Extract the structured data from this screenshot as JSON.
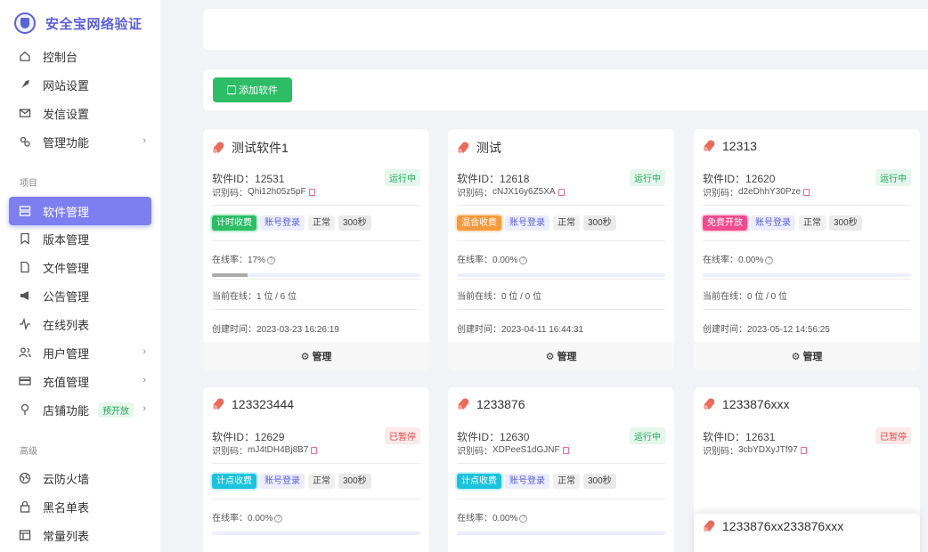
{
  "brand": {
    "title": "安全宝网络验证"
  },
  "sidebar": {
    "items_top": [
      {
        "label": "控制台",
        "icon": "home-icon"
      },
      {
        "label": "网站设置",
        "icon": "rocket-icon"
      },
      {
        "label": "发信设置",
        "icon": "mail-icon"
      },
      {
        "label": "管理功能",
        "icon": "settings-icon",
        "has_children": true
      }
    ],
    "section_project": "项目",
    "items_project": [
      {
        "label": "软件管理",
        "icon": "server-icon",
        "active": true
      },
      {
        "label": "版本管理",
        "icon": "bookmark-icon"
      },
      {
        "label": "文件管理",
        "icon": "file-icon"
      },
      {
        "label": "公告管理",
        "icon": "megaphone-icon"
      },
      {
        "label": "在线列表",
        "icon": "activity-icon"
      },
      {
        "label": "用户管理",
        "icon": "users-icon",
        "has_children": true
      },
      {
        "label": "充值管理",
        "icon": "card-icon",
        "has_children": true
      },
      {
        "label": "店铺功能",
        "icon": "shop-icon",
        "has_children": true,
        "badge": "预开放"
      }
    ],
    "section_advanced": "高级",
    "items_advanced": [
      {
        "label": "云防火墙",
        "icon": "globe-icon"
      },
      {
        "label": "黑名单表",
        "icon": "lock-icon"
      },
      {
        "label": "常量列表",
        "icon": "table-icon"
      }
    ]
  },
  "toolbar": {
    "add_label": "添加软件"
  },
  "labels": {
    "id_prefix": "软件ID：",
    "code_prefix": "识别码：",
    "online_rate": "在线率：",
    "current_online": "当前在线：",
    "created": "创建时间：",
    "manage": "管理"
  },
  "cards": [
    {
      "name": "测试软件1",
      "id": "12531",
      "code": "Qhi12h05z5pF",
      "status": "运行中",
      "status_type": "run",
      "billing": "计时收费",
      "billing_color": "green",
      "login": "账号登录",
      "state": "正常",
      "interval": "300秒",
      "rate": "17%",
      "rate_value": 0.17,
      "current": "1 位 / 6 位",
      "created": "2023-03-23 16:26:19"
    },
    {
      "name": "测试",
      "id": "12618",
      "code": "cNJX16y6Z5XA",
      "status": "运行中",
      "status_type": "run",
      "billing": "混合收费",
      "billing_color": "orange",
      "login": "账号登录",
      "state": "正常",
      "interval": "300秒",
      "rate": "0.00%",
      "rate_value": 0,
      "current": "0 位 / 0 位",
      "created": "2023-04-11 16:44:31"
    },
    {
      "name": "12313",
      "id": "12620",
      "code": "d2eDhhY30Pze",
      "status": "运行中",
      "status_type": "run",
      "billing": "免费开放",
      "billing_color": "pink",
      "login": "账号登录",
      "state": "正常",
      "interval": "300秒",
      "rate": "0.00%",
      "rate_value": 0,
      "current": "0 位 / 0 位",
      "created": "2023-05-12 14:56:25"
    },
    {
      "name": "123323444",
      "id": "12629",
      "code": "mJ4tDH4Bj8B7",
      "status": "已暂停",
      "status_type": "stop",
      "billing": "计点收费",
      "billing_color": "cyan",
      "login": "账号登录",
      "state": "正常",
      "interval": "300秒",
      "rate": "0.00%",
      "rate_value": 0
    },
    {
      "name": "1233876",
      "id": "12630",
      "code": "XDPeeS1dGJNF",
      "status": "运行中",
      "status_type": "run",
      "billing": "计点收费",
      "billing_color": "cyan",
      "login": "账号登录",
      "state": "正常",
      "interval": "300秒",
      "rate": "0.00%",
      "rate_value": 0
    },
    {
      "name": "1233876xxx",
      "id": "12631",
      "code": "3cbYDXyJTf97",
      "status": "已暂停",
      "status_type": "stop"
    }
  ],
  "overlay_card": {
    "name": "1233876xx233876xxx"
  }
}
